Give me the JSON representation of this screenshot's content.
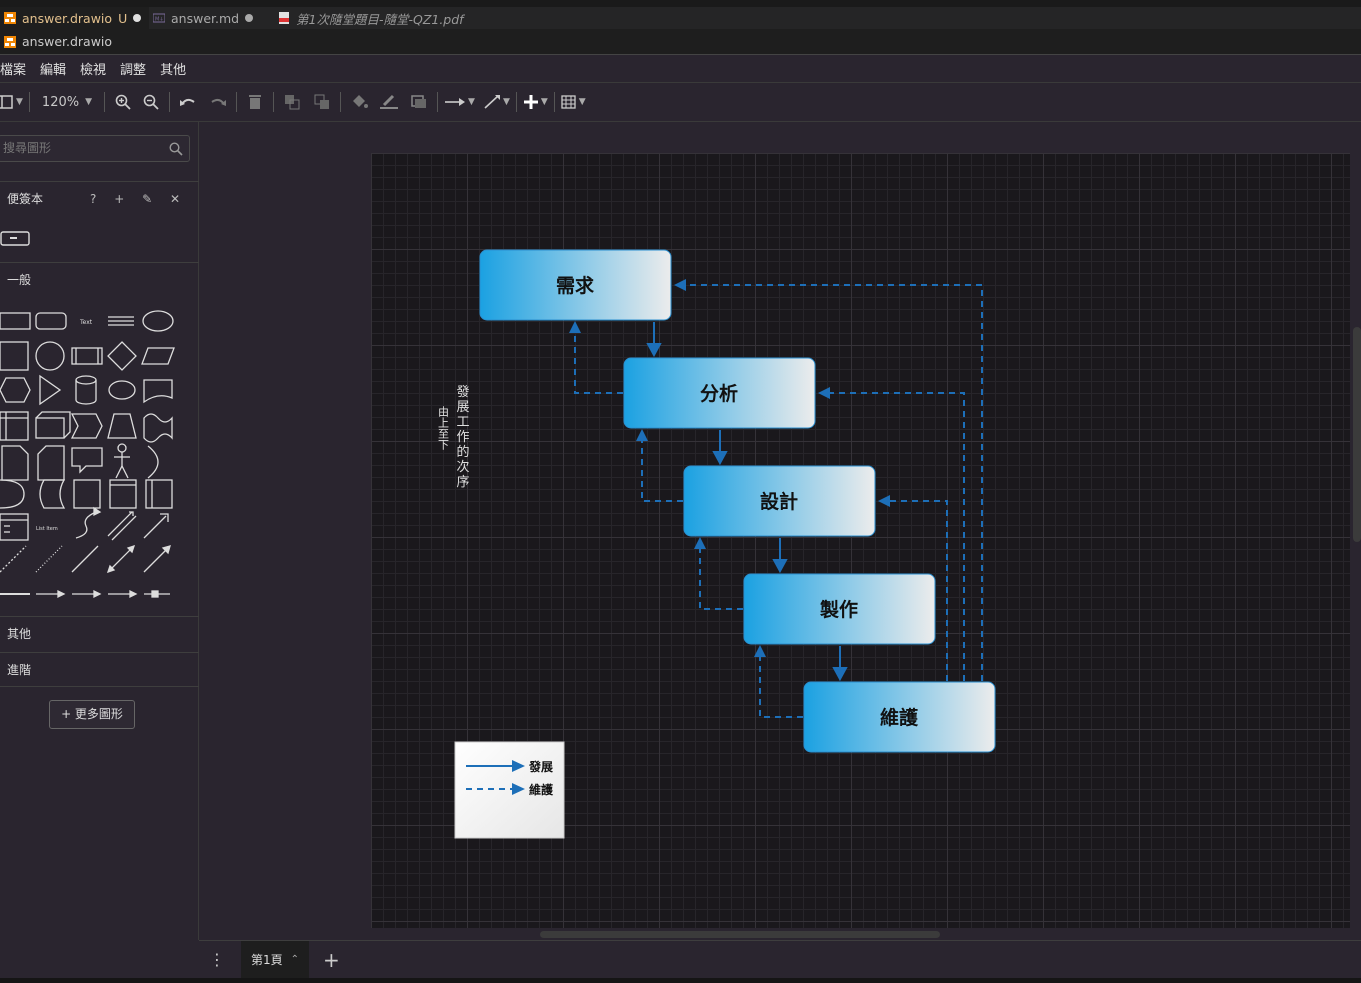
{
  "tabs": [
    {
      "label": "answer.drawio",
      "status": "U",
      "active": true
    },
    {
      "label": "answer.md",
      "active": false
    },
    {
      "label": "第1次隨堂題目-隨堂-QZ1.pdf",
      "active": false
    }
  ],
  "breadcrumb": {
    "file": "answer.drawio"
  },
  "menu": [
    "檔案",
    "編輯",
    "檢視",
    "調整",
    "其他"
  ],
  "toolbar": {
    "zoom": "120%"
  },
  "sidebar": {
    "search_placeholder": "搜尋圖形",
    "scratchpad": {
      "label": "便簽本",
      "tools": "? + ✎ ✕"
    },
    "general": "一般",
    "misc": "其他",
    "advanced": "進階",
    "more_shapes": "+ 更多圖形"
  },
  "diagram": {
    "nodes": [
      "需求",
      "分析",
      "設計",
      "製作",
      "維護"
    ],
    "vertical_title": "發展工作的次序",
    "vertical_subtitle": "由上至下",
    "legend": {
      "solid": "發展",
      "dashed": "維護"
    },
    "colors": {
      "node_left": "#1ba1e2",
      "node_right": "#ececec",
      "arrow": "#1d6fb8"
    }
  },
  "footer": {
    "page_tab": "第1頁"
  }
}
